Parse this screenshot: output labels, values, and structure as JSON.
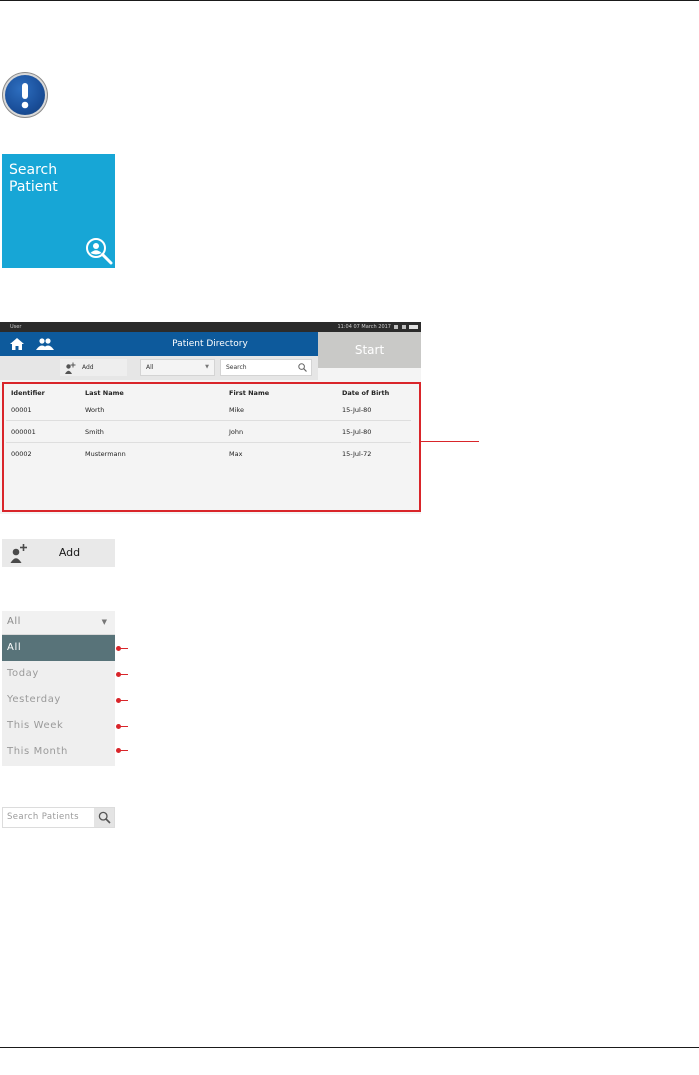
{
  "search_tile": {
    "label_line1": "Search",
    "label_line2": "Patient",
    "icon": "user-search-icon",
    "color": "#17a6d6"
  },
  "warning_icon": "exclamation-icon",
  "directory_screen": {
    "status_user": "User",
    "status_time": "11:04 07 March 2017",
    "title": "Patient Directory",
    "start_label": "Start",
    "add_label": "Add",
    "filter_value": "All",
    "search_placeholder": "Search",
    "columns": [
      "Identifier",
      "Last Name",
      "First Name",
      "Date of Birth"
    ],
    "rows": [
      [
        "00001",
        "Worth",
        "Mike",
        "15-Jul-80"
      ],
      [
        "000001",
        "Smith",
        "John",
        "15-Jul-80"
      ],
      [
        "00002",
        "Mustermann",
        "Max",
        "15-Jul-72"
      ]
    ],
    "header_color": "#0d5a9c",
    "highlight_color": "#d9252a"
  },
  "add_button": {
    "label": "Add",
    "icon": "add-user-icon"
  },
  "filter_dropdown": {
    "selected": "All",
    "options": [
      "All",
      "Today",
      "Yesterday",
      "This Week",
      "This Month"
    ]
  },
  "search_field": {
    "placeholder": "Search Patients",
    "icon": "search-icon"
  }
}
